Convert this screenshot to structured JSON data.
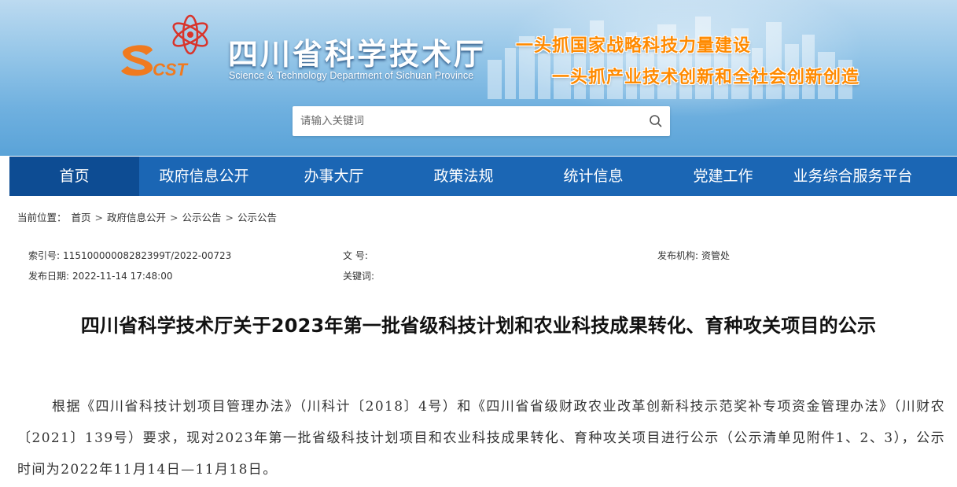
{
  "header": {
    "logo_text": "SCST",
    "site_title": "四川省科学技术厅",
    "site_subtitle": "Science & Technology Department of Sichuan Province",
    "slogan_1": "一头抓国家战略科技力量建设",
    "slogan_2": "一头抓产业技术创新和全社会创新创造",
    "colors": {
      "banner": "#6fb0df",
      "slogan": "#ff8a00",
      "nav": "#1b66b4",
      "nav_active": "#0d4c93"
    }
  },
  "search": {
    "placeholder": "请输入关键词",
    "icon": "search-icon"
  },
  "nav": {
    "items": [
      {
        "label": "首页",
        "active": true
      },
      {
        "label": "政府信息公开"
      },
      {
        "label": "办事大厅"
      },
      {
        "label": "政策法规"
      },
      {
        "label": "统计信息"
      },
      {
        "label": "党建工作"
      },
      {
        "label": "业务综合服务平台"
      }
    ]
  },
  "breadcrumb": {
    "prefix": "当前位置：",
    "items": [
      "首页",
      "政府信息公开",
      "公示公告",
      "公示公告"
    ],
    "separator": ">"
  },
  "meta": {
    "index_label": "索引号:",
    "index_value": "11510000008282399T/2022-00723",
    "doc_no_label": "文 号:",
    "doc_no_value": "",
    "publisher_label": "发布机构:",
    "publisher_value": "资管处",
    "date_label": "发布日期:",
    "date_value": "2022-11-14 17:48:00",
    "keywords_label": "关键词:",
    "keywords_value": ""
  },
  "article": {
    "title": "四川省科学技术厅关于2023年第一批省级科技计划和农业科技成果转化、育种攻关项目的公示",
    "paragraph_1": "根据《四川省科技计划项目管理办法》（川科计〔2018〕4号）和《四川省省级财政农业改革创新科技示范奖补专项资金管理办法》（川财农〔2021〕139号）要求，现对2023年第一批省级科技计划项目和农业科技成果转化、育种攻关项目进行公示（公示清单见附件1、2、3），公示时间为2022年11月14日—11月18日。"
  }
}
